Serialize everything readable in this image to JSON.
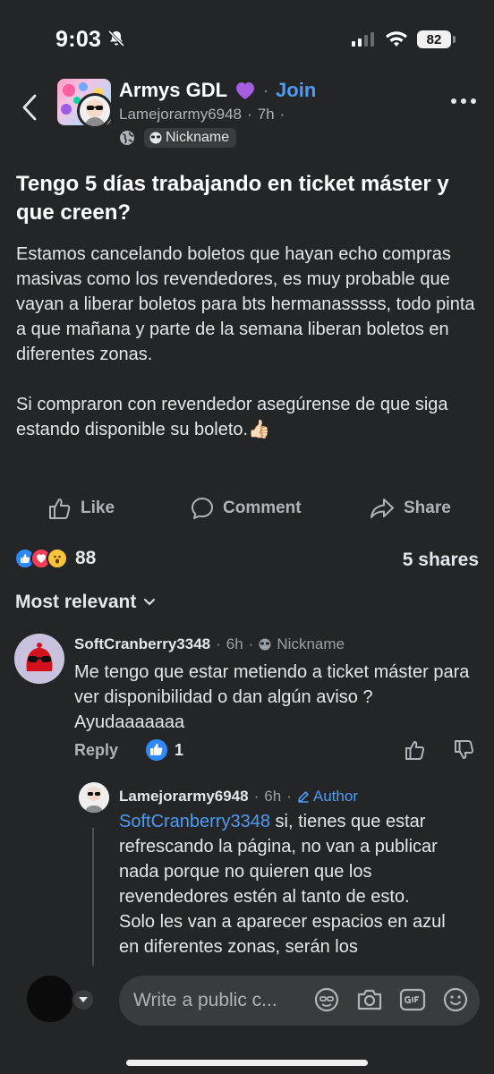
{
  "status": {
    "time": "9:03",
    "battery": "82"
  },
  "header": {
    "group_name": "Armys GDL",
    "join_label": "Join",
    "author": "Lamejorarmy6948",
    "time_ago": "7h",
    "meta_sep": "·",
    "badge": "Nickname"
  },
  "post": {
    "title": "Tengo 5 días trabajando en ticket máster y que creen?",
    "paragraph1": "Estamos cancelando boletos que hayan echo compras masivas como los revendedores, es muy probable que vayan a liberar boletos para bts hermanasssss, todo pinta a que mañana y parte de la semana liberan boletos en diferentes zonas.",
    "paragraph2": "Si compraron con revendedor asegúrense de que siga estando disponible su boleto.👍🏻"
  },
  "actions": {
    "like": "Like",
    "comment": "Comment",
    "share": "Share"
  },
  "stats": {
    "reactions": "88",
    "shares": "5 shares"
  },
  "sort": {
    "label": "Most relevant"
  },
  "comment1": {
    "name": "SoftCranberry3348",
    "time": "6h",
    "badge": "Nickname",
    "text": "Me tengo que estar metiendo a ticket máster para ver disponibilidad o dan algún aviso ? Ayudaaaaaaa",
    "reply_label": "Reply",
    "likes": "1"
  },
  "reply1": {
    "name": "Lamejorarmy6948",
    "time": "6h",
    "author_label": "Author",
    "mention": "SoftCranberry3348",
    "text": " si, tienes que estar refrescando la página, no van a publicar nada porque no quieren que los revendedores estén al tanto de esto.",
    "text2": "Solo les van a aparecer espacios en azul en diferentes zonas, serán los"
  },
  "composer": {
    "placeholder": "Write a public c..."
  },
  "colors": {
    "background": "#242526",
    "accent": "#4e9bf5",
    "text": "#e4e6eb",
    "muted": "#b0b3b8"
  }
}
